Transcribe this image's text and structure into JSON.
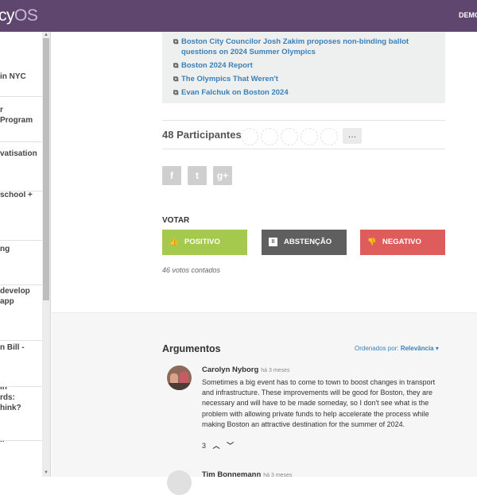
{
  "topbar": {
    "logo_part1": "cy",
    "logo_part2": "OS",
    "right_label": "DEMO"
  },
  "sidebar": {
    "items": [
      {
        "label": "in NYC"
      },
      {
        "label": "r\nProgram"
      },
      {
        "label": "vatisation"
      },
      {
        "label": "school +"
      },
      {
        "label": "Local\nng"
      },
      {
        "label": "develop\napp"
      },
      {
        "label": "n Bill -"
      },
      {
        "label": "in\nrds:\nhink?"
      },
      {
        "label": "ır"
      }
    ]
  },
  "related_links": [
    {
      "icon": "external-link-icon",
      "text": "Boston City Councilor Josh Zakim proposes non-binding ballot"
    },
    {
      "icon": "",
      "text": "questions on 2024 Summer Olympics"
    },
    {
      "icon": "external-link-icon",
      "text": "Boston 2024 Report"
    },
    {
      "icon": "external-link-icon",
      "text": "The Olympics That Weren't"
    },
    {
      "icon": "external-link-icon",
      "text": "Evan Falchuk on Boston 2024"
    }
  ],
  "participants": {
    "label": "48 Participantes",
    "more": "…"
  },
  "share": {
    "facebook": "f",
    "twitter": "t",
    "google": "g+"
  },
  "vote": {
    "label": "VOTAR",
    "positive": "POSITIVO",
    "abstain": "ABSTENÇÃO",
    "negative": "NEGATIVO",
    "count": "46 votos contados",
    "colors": {
      "positive": "#a4c94d",
      "abstain": "#5f5f5f",
      "negative": "#de5c5c"
    }
  },
  "arguments": {
    "title": "Argumentos",
    "order_prefix": "Ordenados por: ",
    "order_value": "Relevância",
    "comments": [
      {
        "author": "Carolyn Nyborg",
        "time": "há 3 meses",
        "text": "Sometimes a big event has to come to town to boost changes in transport and infrastructure. These improvements will be good for Boston, they are necessary and will have to be made someday, so I don't see what is the problem with allowing private funds to help accelerate the process while making Boston an attractive destination for the summer of 2024.",
        "votes": "3"
      },
      {
        "author": "Tim Bonnemann",
        "time": "há 3 meses"
      }
    ]
  }
}
